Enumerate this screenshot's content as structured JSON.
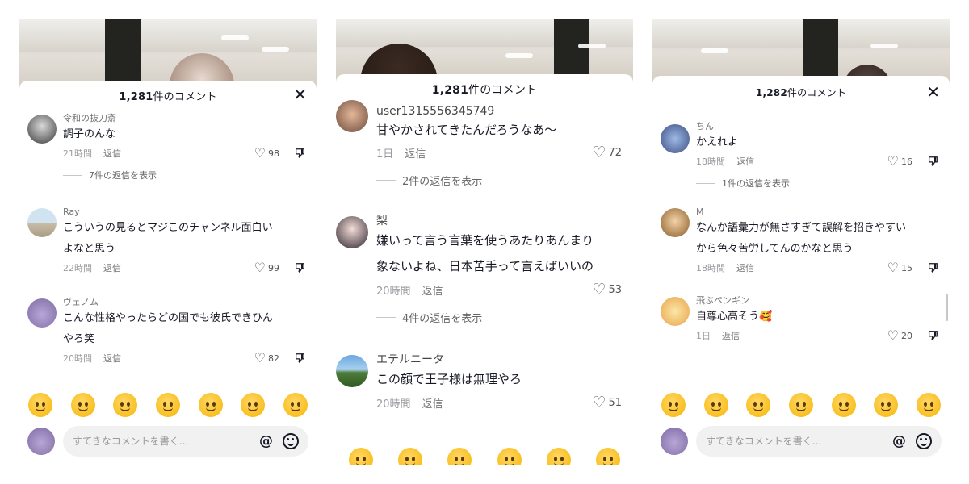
{
  "panels": [
    {
      "header": {
        "count": "1,281",
        "suffix": "件のコメント",
        "close": "✕"
      },
      "comments": [
        {
          "user": "令和の抜刀斎",
          "lines": [
            "調子のんな"
          ],
          "time": "21時間",
          "reply": "返信",
          "likes": "98",
          "replies": "7件の返信を表示"
        },
        {
          "user": "Ray",
          "lines": [
            "こういうの見るとマジこのチャンネル面白い",
            "よなと思う"
          ],
          "time": "22時間",
          "reply": "返信",
          "likes": "99"
        },
        {
          "user": "ヴェノム",
          "lines": [
            "こんな性格やったらどの国でも彼氏できひん",
            "やろ笑"
          ],
          "time": "20時間",
          "reply": "返信",
          "likes": "82"
        }
      ],
      "input": {
        "placeholder": "すてきなコメントを書く...",
        "at": "@"
      }
    },
    {
      "header": {
        "count": "1,281",
        "suffix": "件のコメント"
      },
      "comments": [
        {
          "user": "user1315556345749",
          "lines": [
            "甘やかされてきたんだろうなあ〜"
          ],
          "time": "1日",
          "reply": "返信",
          "likes": "72",
          "replies": "2件の返信を表示"
        },
        {
          "user": "梨",
          "lines": [
            "嫌いって言う言葉を使うあたりあんまり",
            "象ないよね、日本苦手って言えばいいの"
          ],
          "time": "20時間",
          "reply": "返信",
          "likes": "53",
          "replies": "4件の返信を表示"
        },
        {
          "user": "エテルニータ",
          "lines": [
            "この顔で王子様は無理やろ"
          ],
          "time": "20時間",
          "reply": "返信",
          "likes": "51"
        }
      ]
    },
    {
      "header": {
        "count": "1,282",
        "suffix": "件のコメント",
        "close": "✕"
      },
      "comments": [
        {
          "user": "ちん",
          "lines": [
            "かえれよ"
          ],
          "time": "18時間",
          "reply": "返信",
          "likes": "16",
          "replies": "1件の返信を表示"
        },
        {
          "user": "M",
          "lines": [
            "なんか語彙力が無さすぎて誤解を招きやすい",
            "から色々苦労してんのかなと思う"
          ],
          "time": "18時間",
          "reply": "返信",
          "likes": "15"
        },
        {
          "user": "飛ぶペンギン",
          "lines": [
            "自尊心高そう🥰"
          ],
          "time": "1日",
          "reply": "返信",
          "likes": "20"
        }
      ],
      "input": {
        "placeholder": "すてきなコメントを書く...",
        "at": "@"
      }
    }
  ],
  "emojis": [
    "grinning-face",
    "smiling-face-with-hearts",
    "tears-of-joy-face",
    "flushed-face",
    "smirking-face",
    "grinning-sweat-face",
    "pleading-face"
  ],
  "colors": {
    "text": "#161823",
    "muted": "#9a9aa0",
    "input_bg": "#f1f1f2"
  }
}
